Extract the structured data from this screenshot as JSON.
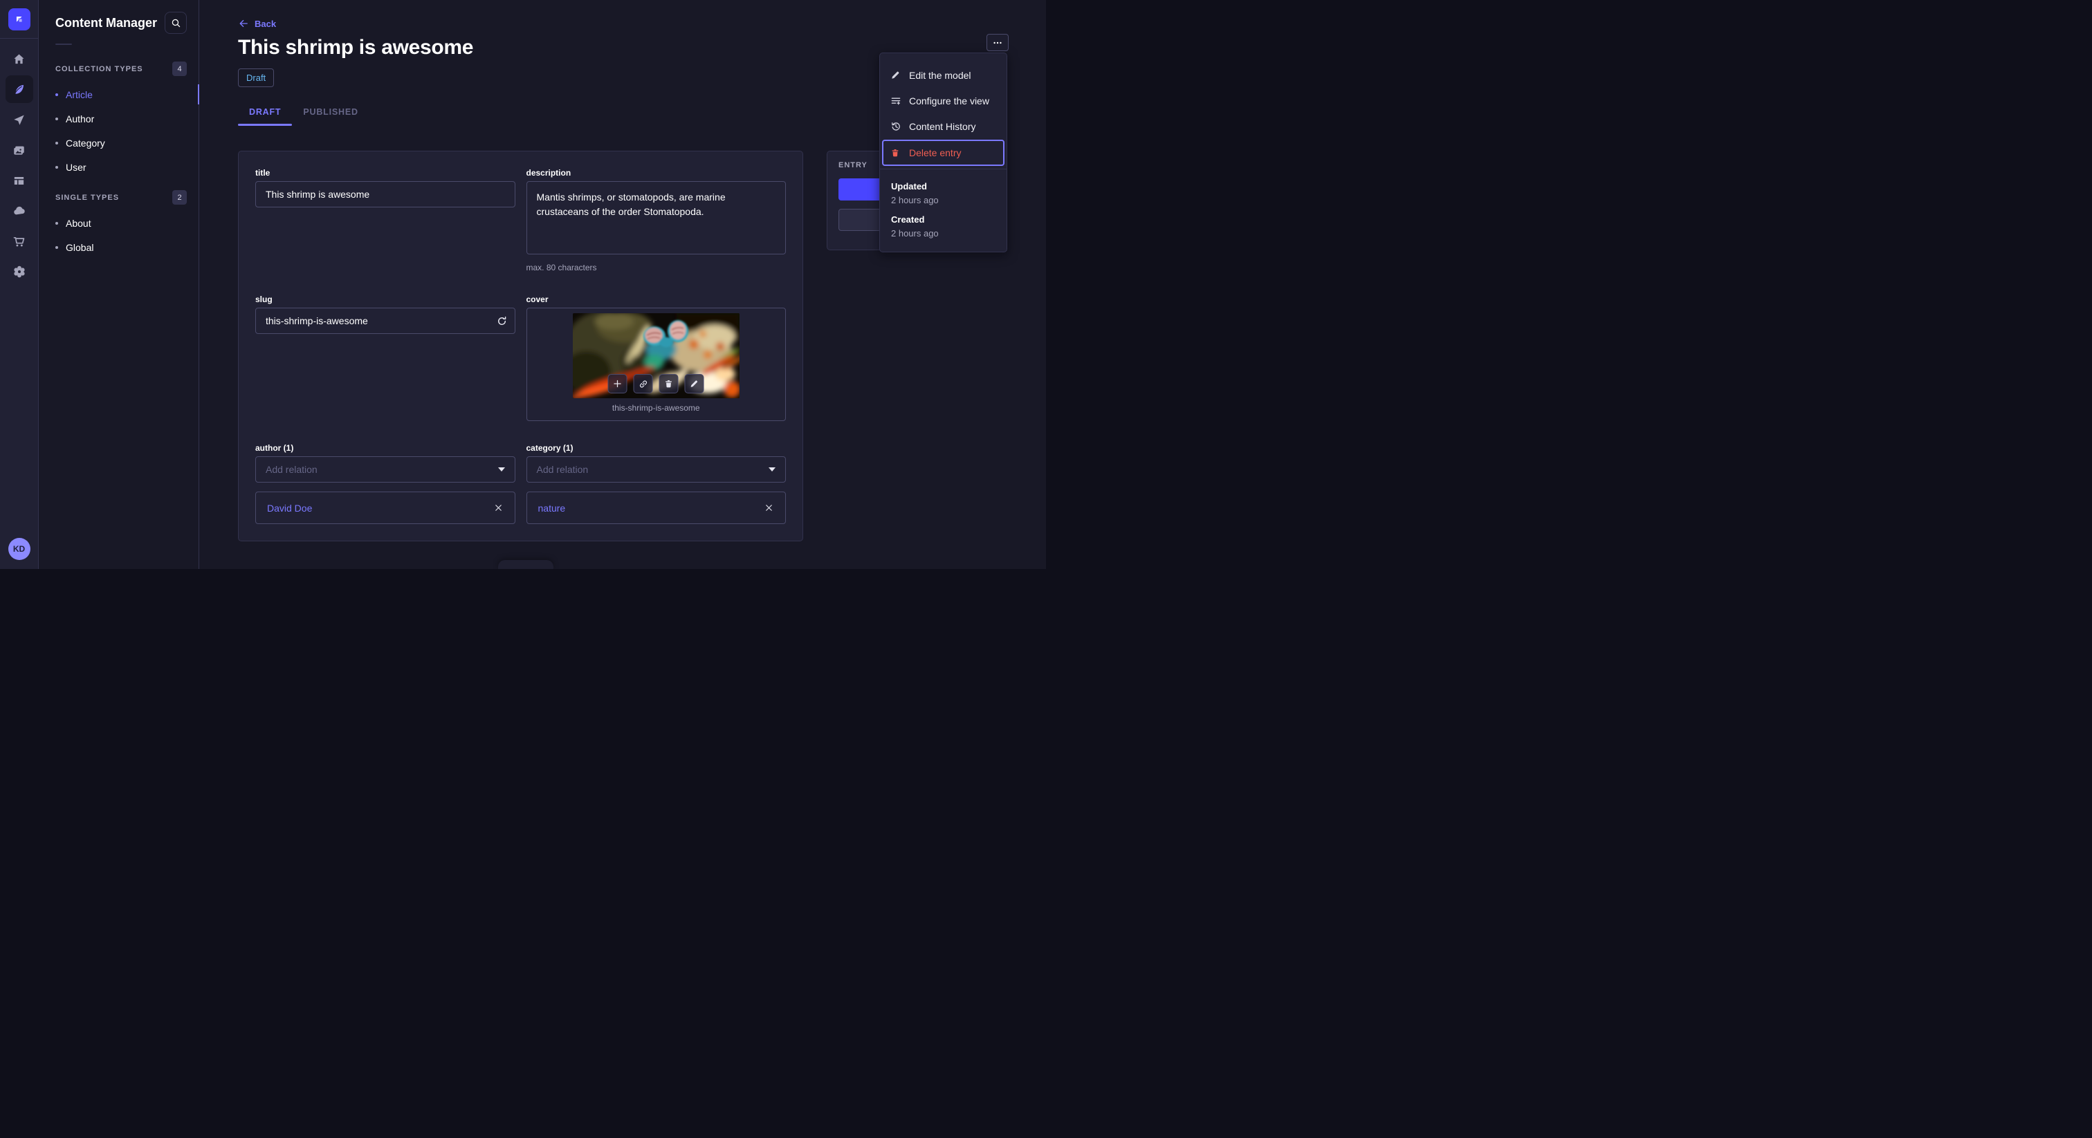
{
  "nav": {
    "avatar_initials": "KD",
    "icons": [
      "strapi-logo",
      "home",
      "content-manager",
      "releases",
      "media-library",
      "content-type-builder",
      "cloud",
      "marketplace",
      "settings"
    ],
    "active_icon": "content-manager"
  },
  "subnav": {
    "title": "Content Manager",
    "sections": [
      {
        "label": "COLLECTION TYPES",
        "count": "4",
        "items": [
          "Article",
          "Author",
          "Category",
          "User"
        ],
        "active_item": "Article"
      },
      {
        "label": "SINGLE TYPES",
        "count": "2",
        "items": [
          "About",
          "Global"
        ]
      }
    ]
  },
  "header": {
    "back": "Back",
    "title": "This shrimp is awesome",
    "status": "Draft",
    "tabs": [
      "DRAFT",
      "PUBLISHED"
    ],
    "active_tab": "DRAFT"
  },
  "more_menu": {
    "items": [
      {
        "label": "Edit the model",
        "icon": "pencil-icon"
      },
      {
        "label": "Configure the view",
        "icon": "configure-list-icon"
      },
      {
        "label": "Content History",
        "icon": "history-icon"
      },
      {
        "label": "Delete entry",
        "icon": "trash-icon",
        "danger": true,
        "highlighted": true
      }
    ],
    "meta": {
      "updated_label": "Updated",
      "updated_value": "2 hours ago",
      "created_label": "Created",
      "created_value": "2 hours ago"
    }
  },
  "entry_panel": {
    "title": "ENTRY"
  },
  "form": {
    "title": {
      "label": "title",
      "value": "This shrimp is awesome"
    },
    "description": {
      "label": "description",
      "value": "Mantis shrimps, or stomatopods, are marine crustaceans of the order Stomatopoda.",
      "hint": "max. 80 characters"
    },
    "slug": {
      "label": "slug",
      "value": "this-shrimp-is-awesome"
    },
    "cover": {
      "label": "cover",
      "caption": "this-shrimp-is-awesome",
      "overlay_icons": [
        "plus-icon",
        "link-icon",
        "trash-icon",
        "pencil-icon"
      ]
    },
    "author": {
      "label": "author (1)",
      "placeholder": "Add relation",
      "relation": "David Doe"
    },
    "category": {
      "label": "category (1)",
      "placeholder": "Add relation",
      "relation": "nature"
    }
  },
  "colors": {
    "background": "#181826",
    "panel": "#212134",
    "border": "#32324d",
    "input_border": "#4a4a6a",
    "accent_purple": "#7b79ff",
    "primary_blue": "#4945ff",
    "danger_red": "#ee5e52",
    "draft_blue": "#66b7f1",
    "muted_text": "#a5a5ba"
  }
}
